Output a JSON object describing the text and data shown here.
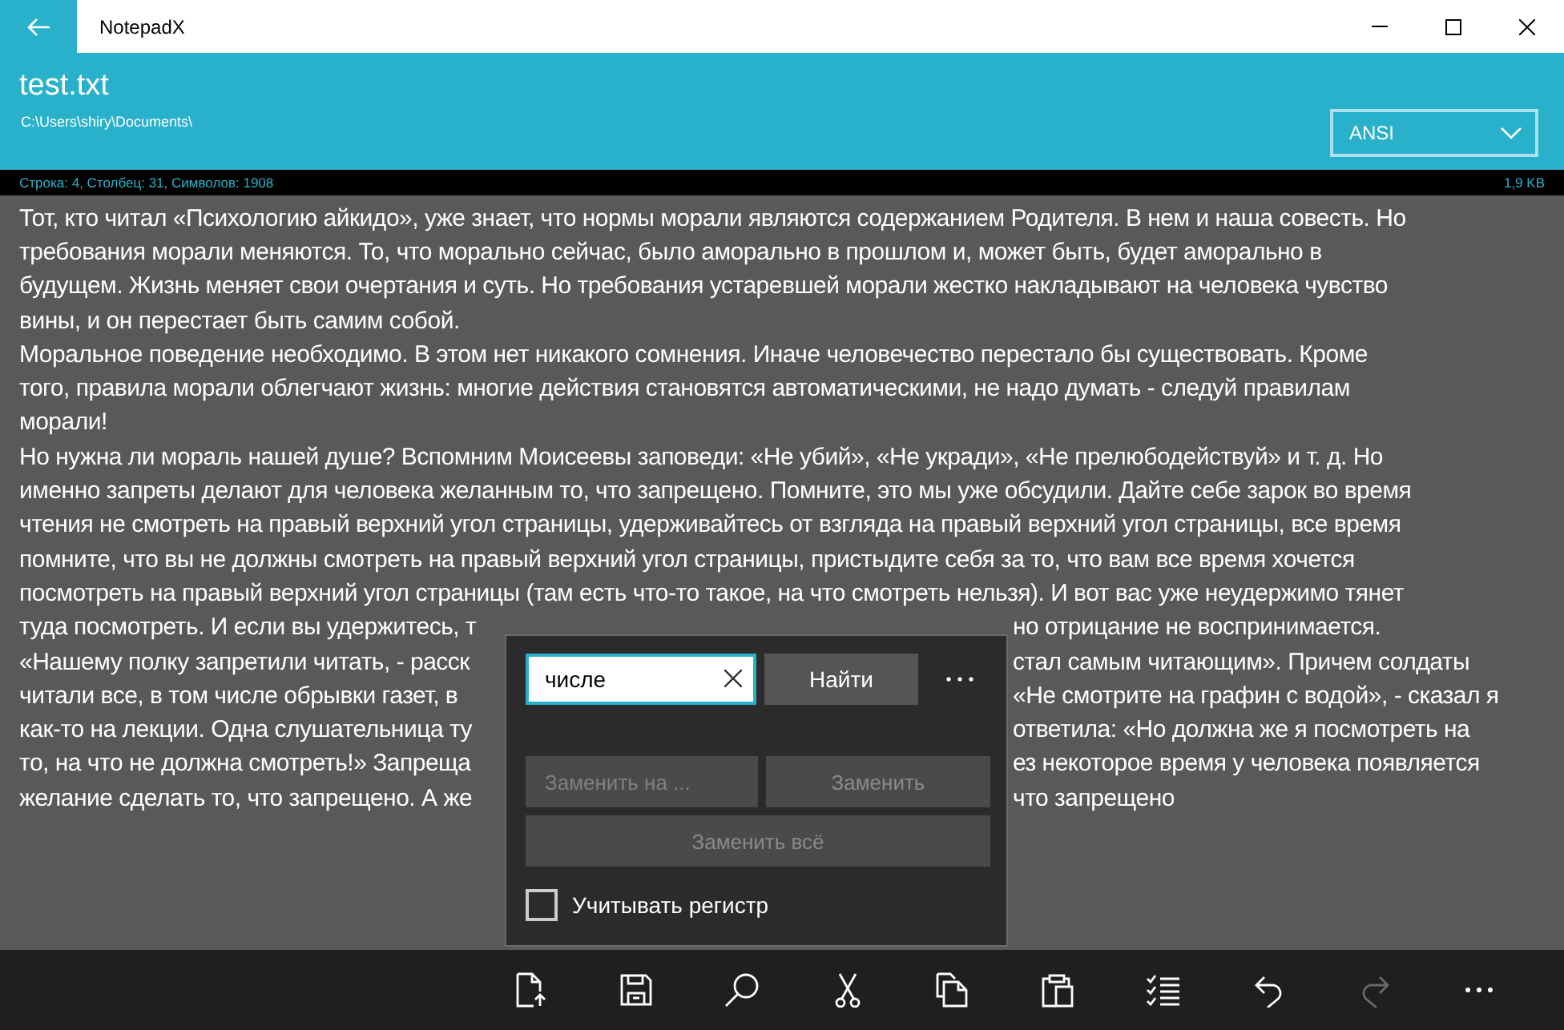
{
  "window": {
    "title": "NotepadX"
  },
  "file": {
    "name": "test.txt",
    "path": "C:\\Users\\shiry\\Documents\\",
    "encoding": "ANSI"
  },
  "status_bar": {
    "position": "Строка: 4, Столбец: 31, Символов: 1908",
    "size": "1,9 KB"
  },
  "document": {
    "lines": [
      {
        "segments": [
          "Тот, кто читал «Психологию айкидо», уже знает, что нормы морали являются содержанием Родителя. В нем и наша совесть. Но"
        ]
      },
      {
        "segments": [
          "требования морали меняются. То, что морально сейчас, было аморально в прошлом и, может быть, будет аморально в"
        ]
      },
      {
        "segments": [
          "будущем. Жизнь меняет свои очертания и суть. Но требования устаревшей морали жестко накладывают на человека чувство"
        ]
      },
      {
        "segments": [
          "вины, и он перестает быть самим собой."
        ]
      },
      {
        "segments": [
          "Моральное поведение необходимо. В этом нет никакого сомнения. Иначе человечество перестало бы существовать. Кроме"
        ]
      },
      {
        "segments": [
          "того, правила морали облегчают жизнь: многие действия становятся автоматическими, не надо думать - следуй правилам"
        ]
      },
      {
        "segments": [
          "морали!"
        ]
      },
      {
        "segments": [
          "Но нужна ли мораль нашей душе? Вспомним Моисеевы заповеди: «Не убий», «Не укради», «Не прелюбодействуй» и т. д. Но"
        ]
      },
      {
        "segments": [
          "именно запреты делают для человека желанным то, что запрещено. Помните, это мы уже обсудили. Дайте себе зарок во время"
        ]
      },
      {
        "segments": [
          "чтения не смотреть на правый верхний угол страницы, удерживайтесь от взгляда на правый верхний угол страницы, все время"
        ]
      },
      {
        "segments": [
          "помните, что вы не должны смотреть на правый верхний угол страницы, пристыдите себя за то, что вам все время хочется"
        ]
      },
      {
        "segments": [
          "посмотреть на правый верхний угол страницы (там есть что-то такое, на что смотреть нельзя). И вот вас уже неудержимо тянет"
        ]
      },
      {
        "segments": [
          "туда посмотреть. И если вы удержитесь, т",
          "но отрицание не воспринимается."
        ]
      },
      {
        "segments": [
          "«Нашему полку запретили читать, - расск",
          "стал самым читающим». Причем солдаты"
        ]
      },
      {
        "segments": [
          "читали все, в том числе обрывки газет, в",
          "«Не смотрите на графин с водой», - сказал я"
        ]
      },
      {
        "segments": [
          "как-то на лекции. Одна слушательница ту",
          "ответила: «Но должна же я посмотреть на"
        ]
      },
      {
        "segments": [
          "то, на что не должна смотреть!» Запреща",
          "ез некоторое время у человека появляется"
        ]
      },
      {
        "segments": [
          "желание сделать то, что запрещено. А же",
          "что запрещено"
        ]
      }
    ]
  },
  "find_dialog": {
    "search": {
      "value": "числе"
    },
    "find_button": "Найти",
    "replace_field": {
      "placeholder": "Заменить на ...",
      "disabled": true
    },
    "replace_button": {
      "label": "Заменить",
      "disabled": true
    },
    "replace_all_button": {
      "label": "Заменить всё",
      "disabled": true
    },
    "match_case": {
      "label": "Учитывать регистр",
      "checked": false
    }
  },
  "toolbar": {
    "items": [
      {
        "kind": "open",
        "disabled": false
      },
      {
        "kind": "save",
        "disabled": false
      },
      {
        "kind": "search",
        "disabled": false
      },
      {
        "kind": "cut",
        "disabled": false
      },
      {
        "kind": "copy",
        "disabled": false
      },
      {
        "kind": "paste",
        "disabled": false
      },
      {
        "kind": "select",
        "disabled": false
      },
      {
        "kind": "undo",
        "disabled": false
      },
      {
        "kind": "redo",
        "disabled": true
      },
      {
        "kind": "more",
        "disabled": false
      }
    ]
  }
}
